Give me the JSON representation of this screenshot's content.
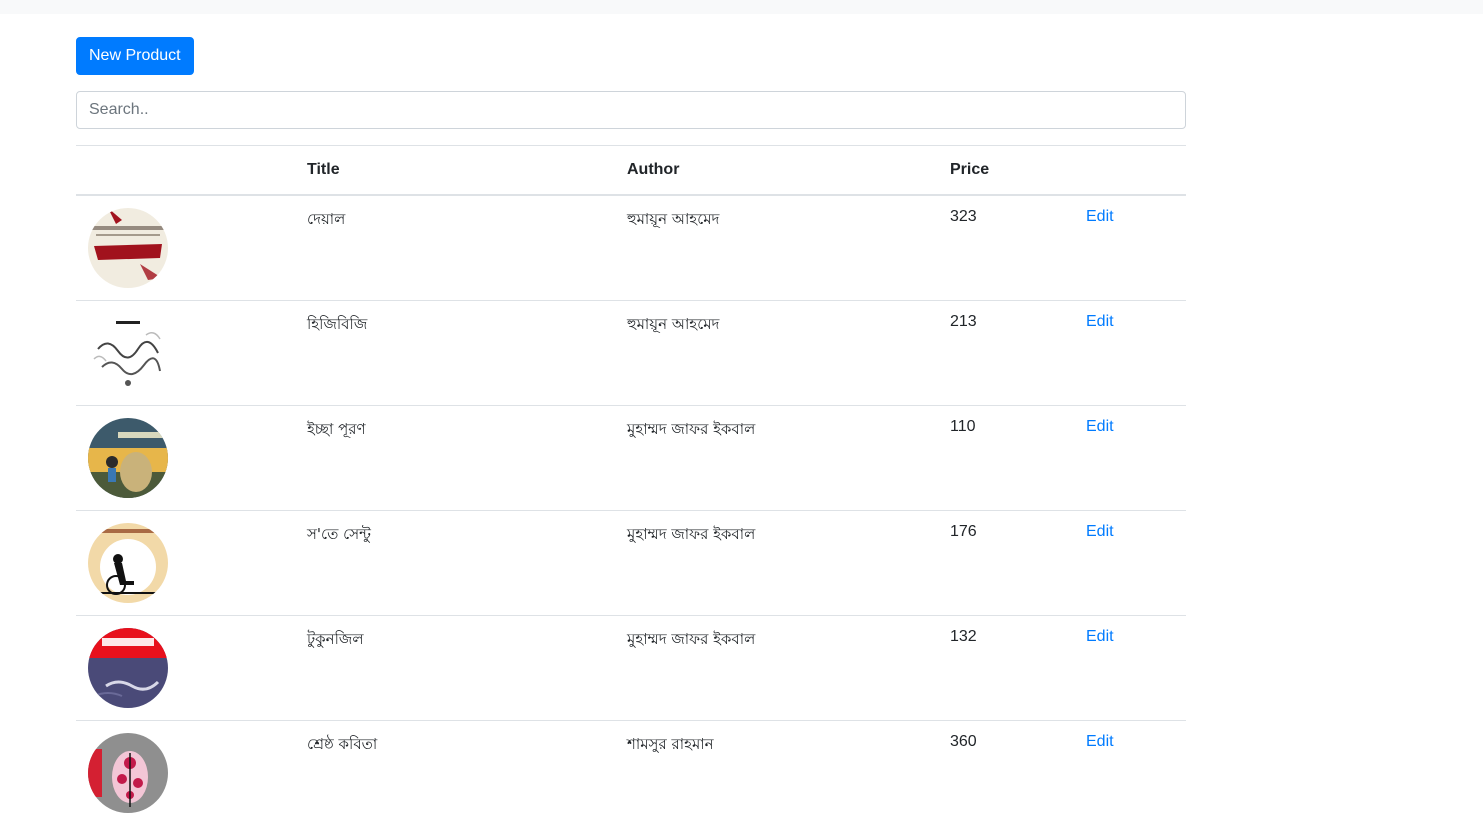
{
  "toolbar": {
    "new_product_label": "New Product"
  },
  "search": {
    "placeholder": "Search..",
    "value": ""
  },
  "table": {
    "headers": [
      "",
      "Title",
      "Author",
      "Price",
      ""
    ],
    "rows": [
      {
        "title": "দেয়াল",
        "author": "হুমায়ূন আহমেদ",
        "price": "323",
        "action": "Edit"
      },
      {
        "title": "হিজিবিজি",
        "author": "হুমায়ূন আহমেদ",
        "price": "213",
        "action": "Edit"
      },
      {
        "title": "ইচ্ছা পূরণ",
        "author": "মুহাম্মদ জাফর ইকবাল",
        "price": "110",
        "action": "Edit"
      },
      {
        "title": "স'তে সেন্টু",
        "author": "মুহাম্মদ জাফর ইকবাল",
        "price": "176",
        "action": "Edit"
      },
      {
        "title": "টুকুনজিল",
        "author": "মুহাম্মদ জাফর ইকবাল",
        "price": "132",
        "action": "Edit"
      },
      {
        "title": "শ্রেষ্ঠ কবিতা",
        "author": "শামসুর রাহমান",
        "price": "360",
        "action": "Edit"
      }
    ]
  },
  "colors": {
    "primary": "#007bff",
    "border": "#dee2e6",
    "topbar": "#f8f9fa"
  }
}
